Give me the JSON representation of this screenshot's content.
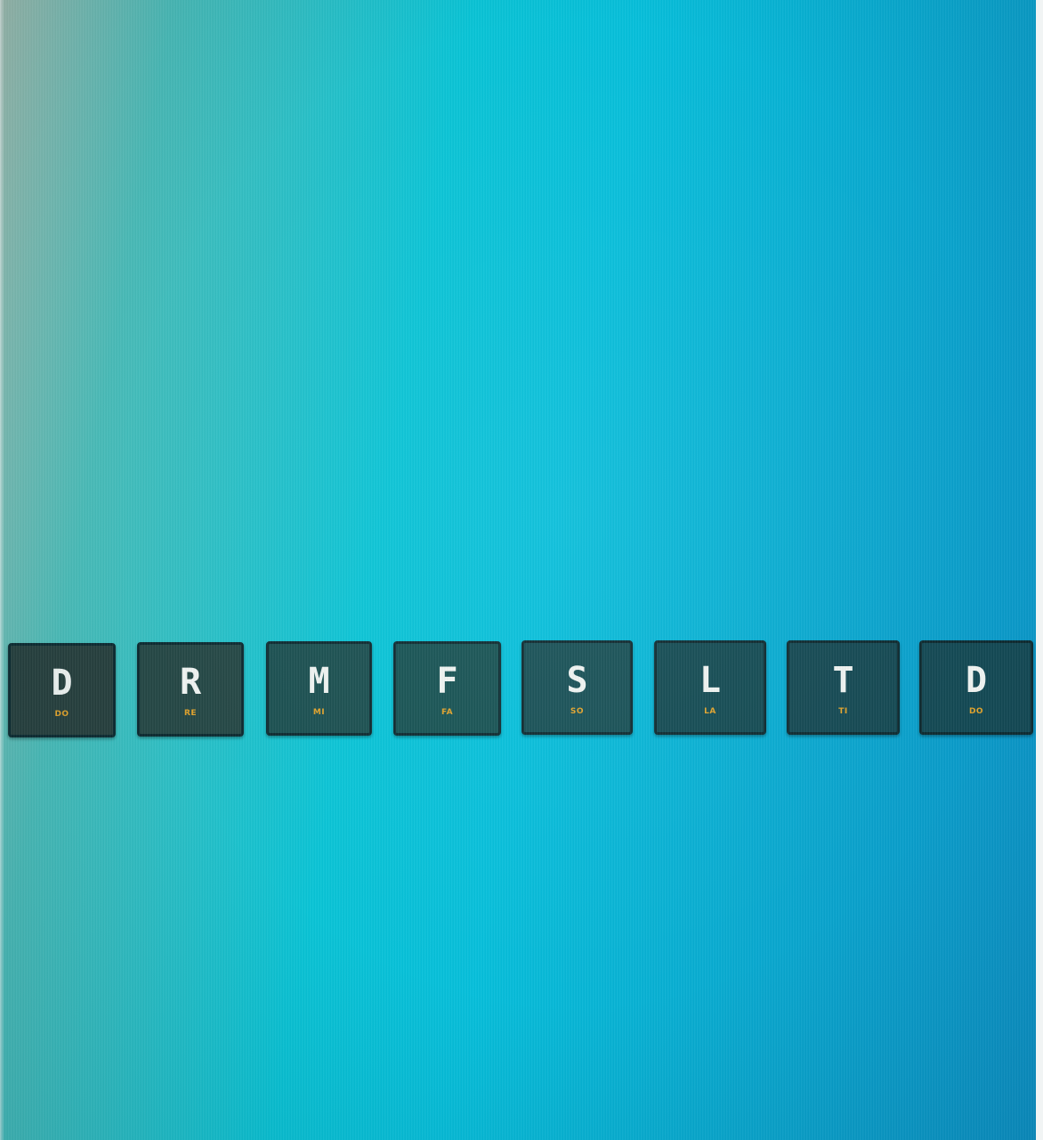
{
  "colors": {
    "key_text": "#eef3f1",
    "key_sub_text": "#e0a22a",
    "key_border": "#0c2a30"
  },
  "keys": [
    {
      "letter": "D",
      "sub": "DO",
      "bg": "#263f3d"
    },
    {
      "letter": "R",
      "sub": "RE",
      "bg": "#244745"
    },
    {
      "letter": "M",
      "sub": "MI",
      "bg": "#1a4f50"
    },
    {
      "letter": "F",
      "sub": "FA",
      "bg": "#165253"
    },
    {
      "letter": "S",
      "sub": "SO",
      "bg": "#164f55"
    },
    {
      "letter": "L",
      "sub": "LA",
      "bg": "#124a52"
    },
    {
      "letter": "T",
      "sub": "TI",
      "bg": "#134852"
    },
    {
      "letter": "D",
      "sub": "DO",
      "bg": "#124853"
    }
  ]
}
